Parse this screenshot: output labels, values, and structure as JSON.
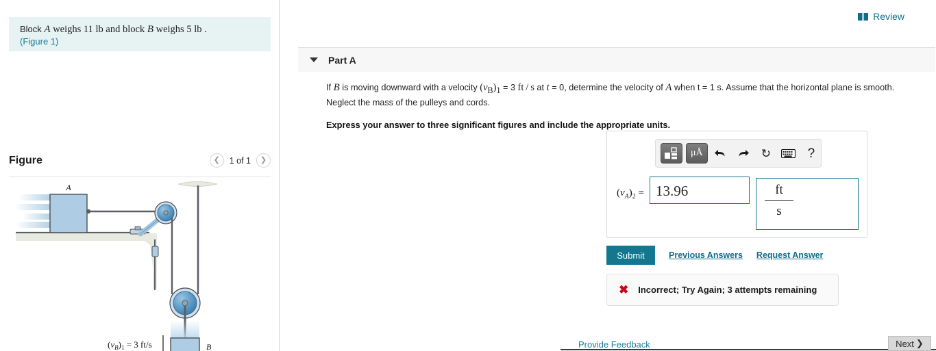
{
  "problem": {
    "text_before_a": "Block ",
    "var_a": "A",
    "text_mid": " weighs 11 lb and block ",
    "var_b": "B",
    "text_after": " weighs 5 lb .",
    "figure_link": "(Figure 1)"
  },
  "figure": {
    "title": "Figure",
    "count_label": "1 of 1",
    "prev_icon": "chevron-left-icon",
    "next_icon": "chevron-right-icon",
    "labels": {
      "block_a": "A",
      "block_b": "B",
      "velocity_b": "(vB)1 = 3 ft/s"
    }
  },
  "review": {
    "label": "Review",
    "icon": "book-icon"
  },
  "part": {
    "title": "Part A",
    "caret_icon": "triangle-down-icon",
    "question_html": "If <i>B</i> is moving downward with a velocity (v<sub>B</sub>)<sub>1</sub> = 3 ft/s at <i>t</i> = 0, determine the velocity of <i>A</i> when t = 1 s. Assume that the horizontal plane is smooth. Neglect the mass of the pulleys and cords.",
    "instruction": "Express your answer to three significant figures and include the appropriate units."
  },
  "toolbar": {
    "buttons": [
      {
        "name": "template-tool",
        "label": ""
      },
      {
        "name": "units-tool",
        "label": "μÅ"
      },
      {
        "name": "undo-tool",
        "label": "↶"
      },
      {
        "name": "redo-tool",
        "label": "↷"
      },
      {
        "name": "reset-tool",
        "label": "↻"
      },
      {
        "name": "keyboard-tool",
        "label": "⌨"
      },
      {
        "name": "help-tool",
        "label": "?"
      }
    ]
  },
  "answer": {
    "label": "(vA)2 =",
    "value": "13.96",
    "units_numerator": "ft",
    "units_denominator": "s"
  },
  "actions": {
    "submit_label": "Submit",
    "previous_answers_label": "Previous Answers",
    "request_answer_label": "Request Answer"
  },
  "feedback": {
    "icon": "x-mark-icon",
    "message": "Incorrect; Try Again; 3 attempts remaining"
  },
  "footer": {
    "provide_feedback_label": "Provide Feedback",
    "next_label": "Next",
    "next_icon": "chevron-right-icon"
  },
  "colors": {
    "accent_teal": "#12778f",
    "panel_bg": "#e7f3f2",
    "error_red": "#d0021b",
    "block_blue": "#aecde4"
  }
}
